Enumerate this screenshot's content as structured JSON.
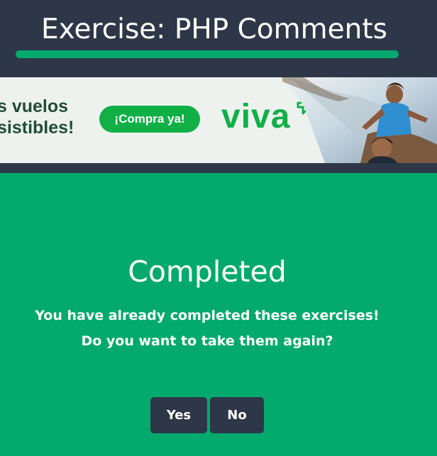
{
  "header": {
    "title": "Exercise: PHP Comments"
  },
  "ad": {
    "line1": "s vuelos",
    "line2": "sistibles!",
    "cta": "¡Compra ya!",
    "logo": "viva"
  },
  "completed": {
    "heading": "Completed",
    "message_line1": "You have already completed these exercises!",
    "message_line2": "Do you want to take them again?",
    "yes_label": "Yes",
    "no_label": "No"
  },
  "colors": {
    "header_bg": "#2d3748",
    "accent_green": "#04aa6d",
    "ad_green": "#10b047",
    "button_bg": "#2d3748"
  }
}
